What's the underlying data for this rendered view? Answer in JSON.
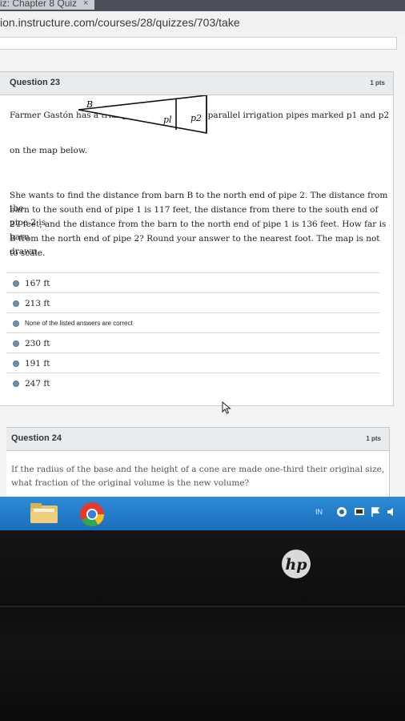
{
  "browser": {
    "tab_title": "iz: Chapter 8 Quiz",
    "tab_close": "×",
    "url": "ion.instructure.com/courses/28/quizzes/703/take"
  },
  "question23": {
    "title": "Question 23",
    "points": "1 pts",
    "text_line1": "Farmer Gastón has a triangular field with two parallel irrigation pipes marked p1 and p2",
    "text_line2": "on the map below.",
    "diagram": {
      "vertex_label": "B",
      "pipe1_label": "pl",
      "pipe2_label": "p2"
    },
    "body_lines": [
      "She wants to find the distance from barn B to the north end of pipe 2. The distance from the",
      "barn to the south end of pipe 1 is 117 feet, the distance from there to the south end of pipe 2 is",
      "27 feet, and the distance from the barn to the north end of pipe 1 is 136 feet. How far is barn",
      "B from the north end of pipe 2? Round your answer to the nearest foot. The map is not drawn",
      "to scale."
    ],
    "answers": [
      "167 ft",
      "213 ft",
      "None of the listed answers are correct",
      "230 ft",
      "191 ft",
      "247 ft"
    ]
  },
  "question24": {
    "title": "Question 24",
    "points": "1 pts",
    "text_lines": [
      "If the radius of the base and the height of a cone are made one-third their original size,",
      "what fraction of the original volume is the new volume?"
    ]
  },
  "taskbar": {
    "icons": [
      "file-explorer-icon",
      "chrome-icon"
    ],
    "tray_language": "IN"
  },
  "device": {
    "logo": "hp"
  }
}
